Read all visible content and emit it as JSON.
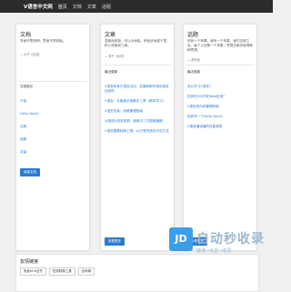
{
  "header": {
    "brand": "V语言中文网",
    "nav": [
      "首页",
      "文档",
      "文章",
      "话题"
    ]
  },
  "cards": [
    {
      "title": "文档",
      "desc": "学而不思则罔，思而不学则殆。",
      "meta": "— 孔子《论语》",
      "section": "文档索引",
      "items": [
        "介绍",
        "Hello World",
        "注释",
        "函数",
        "变量"
      ],
      "button": "阅读文档"
    },
    {
      "title": "文章",
      "desc": "温故而知新，可以为师矣。积硅步而成千里，积小流而成江海。",
      "meta": "— 荀子《劝学》",
      "section": "最近更新",
      "items": [
        "V语言和其它语言对比：还要和那些类似语言比较吗",
        "V语言：长篇演示用脚本工具（脚本学习）",
        "V语言安装：依赖管理指南",
        "以释放V语言资源：使用中三方图像编辑",
        "V语言图像转换工具：从已有的语言中的方法"
      ],
      "button": "查看更多"
    },
    {
      "title": "话题",
      "desc": "你有一个苹果，我有一个苹果，我们交换之后，每个人还是一个苹果；思想交换则各得两种思想。",
      "meta": "— 萧伯纳",
      "section": "最近更新",
      "items": [
        "怎么学习V语言？",
        "如何在V中开发Web应用？",
        "V语言的内存管理机制",
        "如何写一个Hello World",
        "V语言编译器的性能表现"
      ],
      "button": "查看更多"
    }
  ],
  "friend_links": {
    "title": "友情链接",
    "items": [
      "免费VLX证书",
      "在线转换工具",
      "百科网"
    ]
  }
}
